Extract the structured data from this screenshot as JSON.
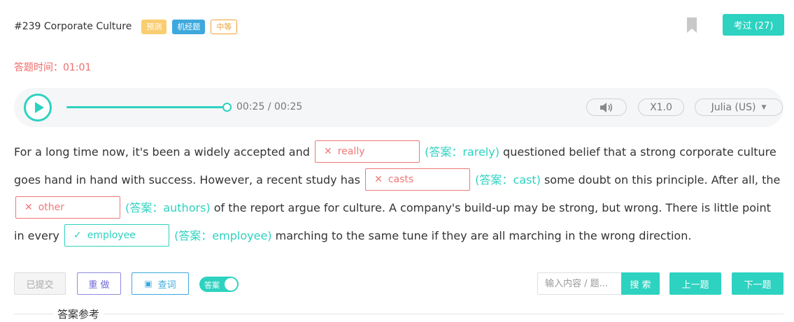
{
  "header": {
    "title": "#239 Corporate Culture",
    "tags": [
      "预测",
      "机经题",
      "中等"
    ],
    "bookmark_icon": "bookmark-icon",
    "exam_button": "考过 (27)"
  },
  "timer": {
    "text": "答题时间：01:01"
  },
  "player": {
    "play_icon": "play-icon",
    "progress": 1.0,
    "time_text": "00:25 / 00:25",
    "volume_icon": "speaker-icon",
    "speed": "X1.0",
    "voice": "Julia (US)",
    "voice_caret": "caret-down-icon"
  },
  "passage": {
    "p1": "For a long time now, it's been a widely accepted and",
    "blank1": {
      "value": "really",
      "status": "wrong",
      "answer": "(答案：rarely)"
    },
    "p2": "questioned belief that a strong corporate culture goes hand in hand with success. However, a recent study has",
    "blank2": {
      "value": "casts",
      "status": "wrong",
      "answer": "(答案：cast)"
    },
    "p3": "some doubt on this principle. After all, the",
    "blank3": {
      "value": "other",
      "status": "wrong",
      "answer": "(答案：authors)"
    },
    "p4": "of the report argue for culture. A company's build-up may be strong, but wrong. There is little point in every",
    "blank4": {
      "value": "employee",
      "status": "correct",
      "answer": "(答案：employee)"
    },
    "p5": "marching to the same tune if they are all marching in the wrong direction.",
    "wrong_mark": "✕",
    "correct_mark": "✓"
  },
  "toolbar": {
    "submitted": "已提交",
    "redo": "重 做",
    "lookup": "查词",
    "toggle_label": "答案",
    "toggle_on": true,
    "search_placeholder": "输入内容 / 题...",
    "search_button": "搜 索",
    "prev": "上一题",
    "next": "下一题"
  },
  "reference": {
    "title": "答案参考"
  },
  "colors": {
    "accent": "#2dd2c0",
    "error": "#f07777",
    "timer": "#f06b6b"
  }
}
